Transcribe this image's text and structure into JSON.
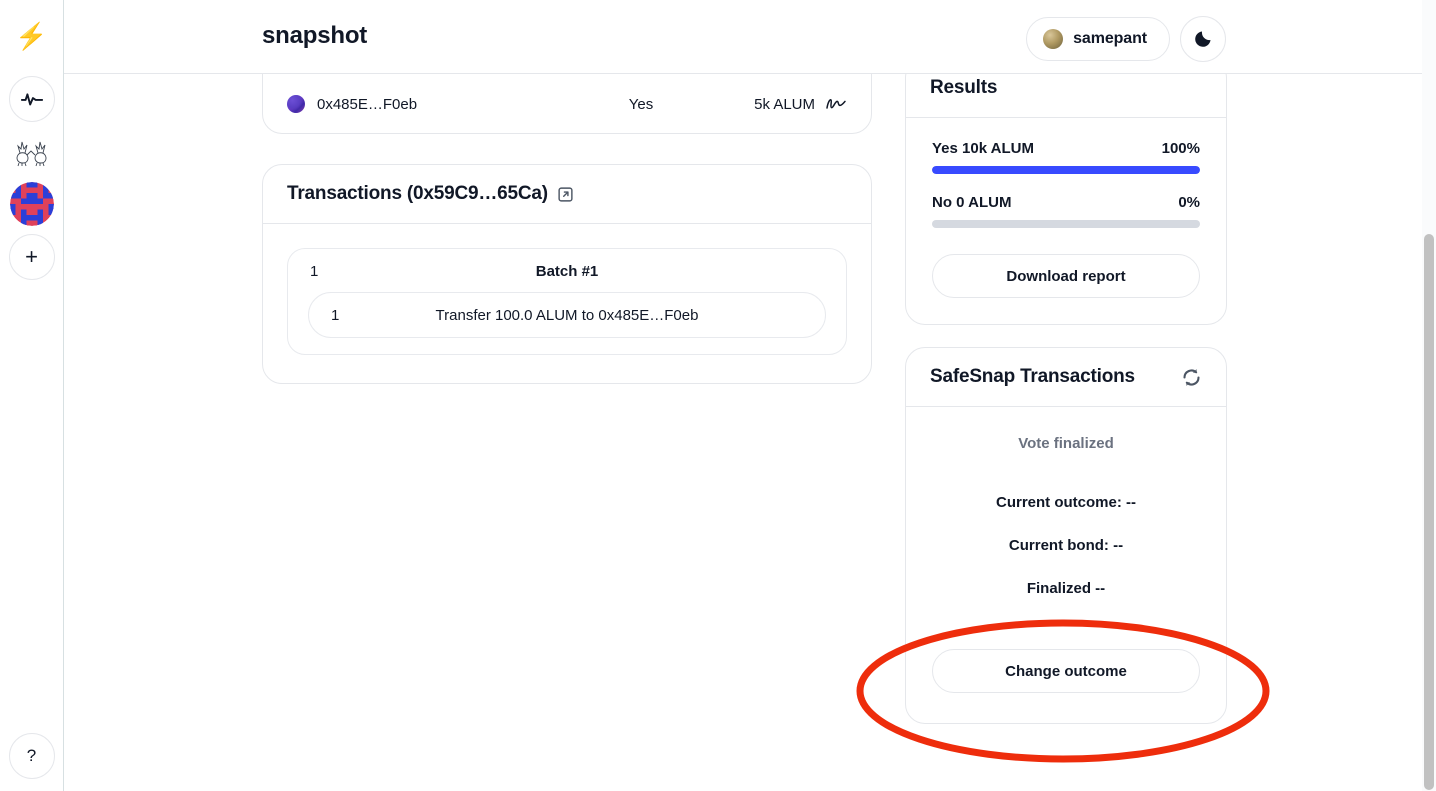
{
  "header": {
    "brand": "snapshot",
    "user": {
      "name": "samepant",
      "avatar_icon": "user-avatar"
    },
    "theme_toggle_icon": "moon-icon"
  },
  "rail": {
    "items": [
      {
        "name": "logo",
        "icon": "lightning-bolt-icon",
        "label": ""
      },
      {
        "name": "activity",
        "icon": "pulse-icon",
        "label": ""
      },
      {
        "name": "space-critters",
        "icon": "critters-icon",
        "label": ""
      },
      {
        "name": "space-alum",
        "icon": "identicon-avatar",
        "label": ""
      },
      {
        "name": "add-space",
        "icon": "plus-icon",
        "label": "+"
      }
    ],
    "help_label": "?"
  },
  "votes": {
    "rows": [
      {
        "address": "0x485E…F0eb",
        "choice": "Yes",
        "power": "5k ALUM",
        "signature_icon": "signature-icon"
      }
    ]
  },
  "transactions": {
    "title": "Transactions (0x59C9…65Ca)",
    "external_link_icon": "external-link-icon",
    "batches": [
      {
        "index": "1",
        "label": "Batch #1",
        "items": [
          {
            "index": "1",
            "description": "Transfer 100.0 ALUM to 0x485E…F0eb"
          }
        ]
      }
    ]
  },
  "results": {
    "title": "Results",
    "choices": [
      {
        "label": "Yes 10k ALUM",
        "percent_label": "100%",
        "percent": 100
      },
      {
        "label": "No 0 ALUM",
        "percent_label": "0%",
        "percent": 0
      }
    ],
    "download_label": "Download report",
    "bar_color": "#384aff",
    "bar_track_color": "#d5d9e0"
  },
  "safesnap": {
    "title": "SafeSnap Transactions",
    "refresh_icon": "refresh-icon",
    "status": "Vote finalized",
    "current_outcome": "Current outcome: --",
    "current_bond": "Current bond: --",
    "finalized": "Finalized --",
    "action_label": "Change outcome"
  },
  "annotation": {
    "shape": "ellipse",
    "color": "#ee2d0c",
    "target": "change-outcome-button"
  }
}
